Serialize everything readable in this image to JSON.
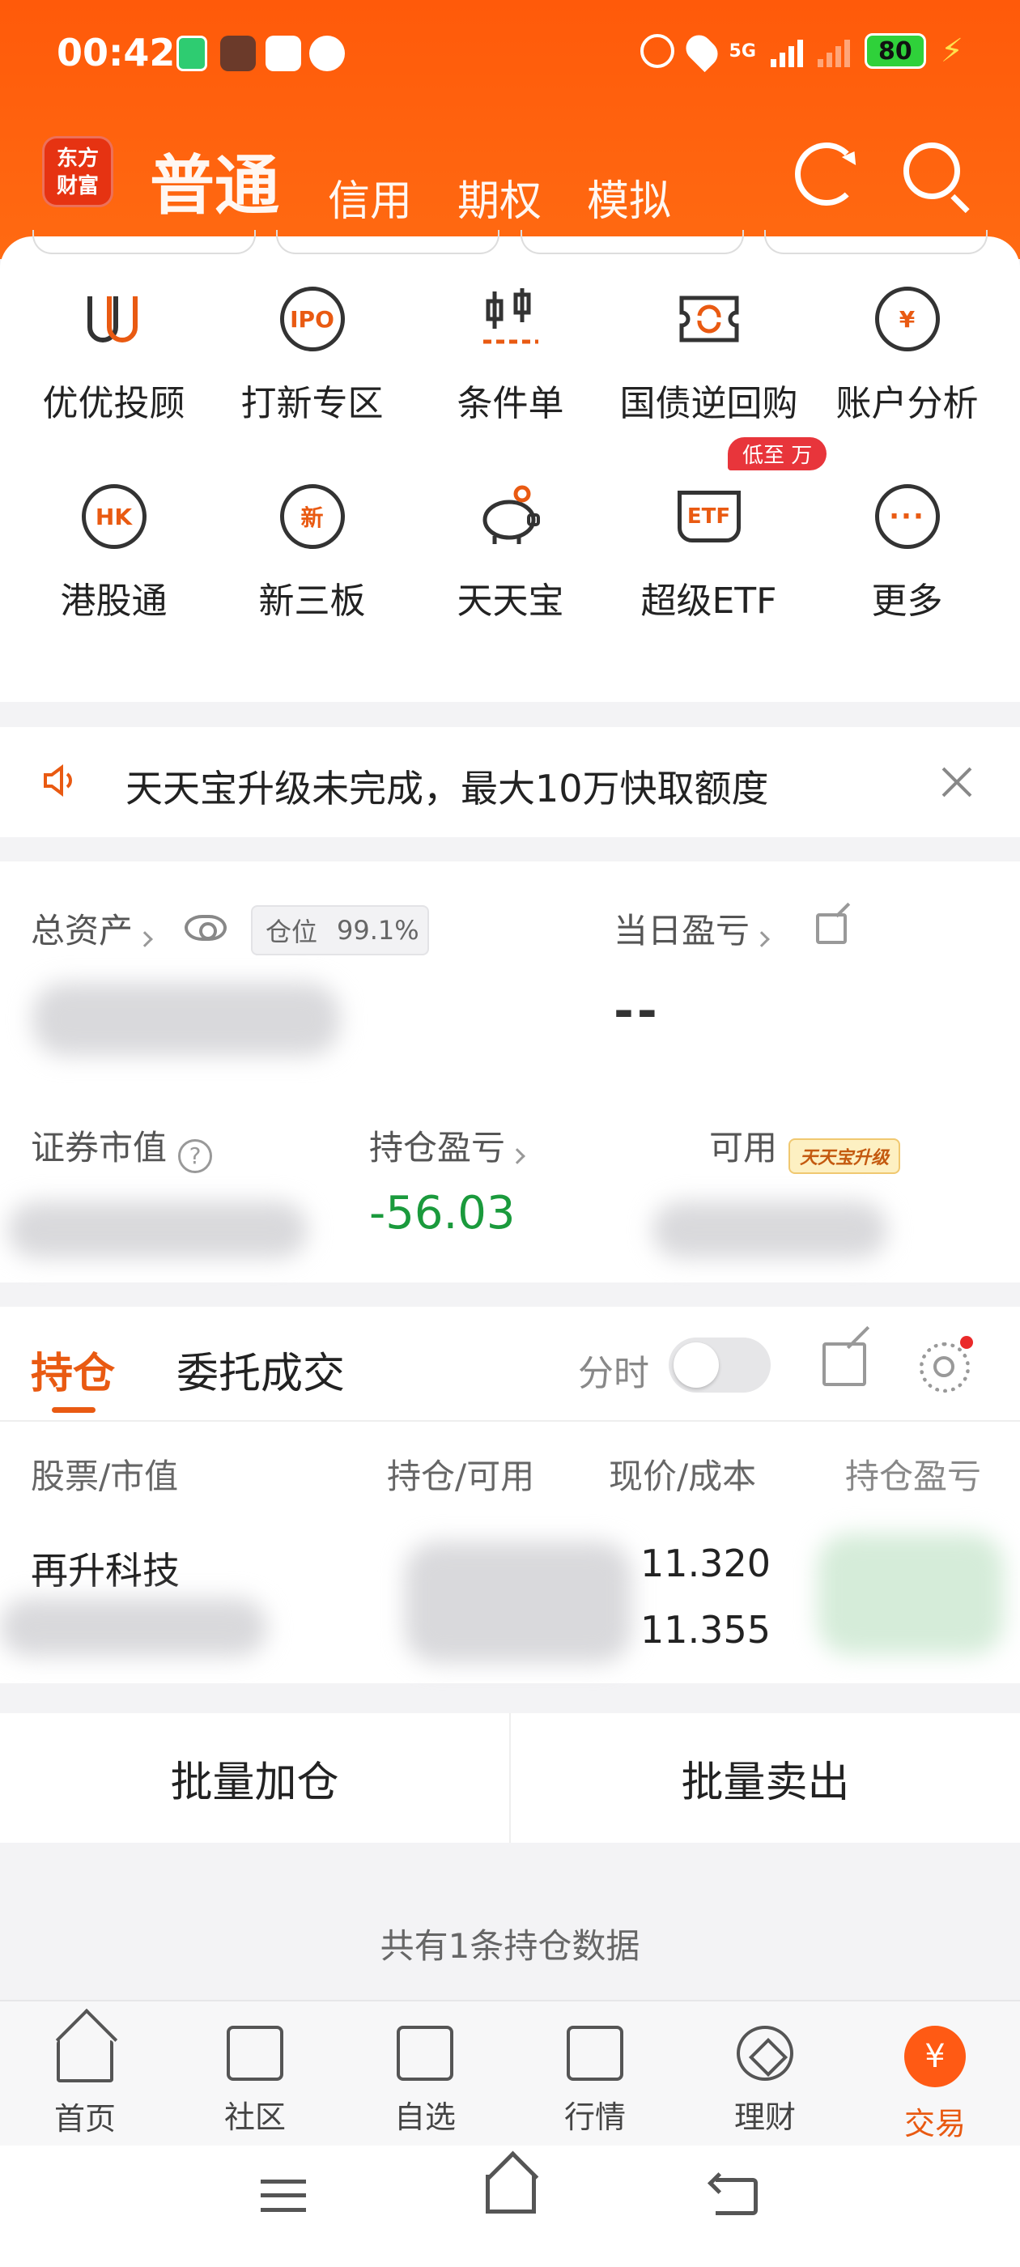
{
  "status_bar": {
    "time": "00:42",
    "network": "5G",
    "battery": "80"
  },
  "header": {
    "logo_text": "东方\n财富",
    "tabs": [
      {
        "label": "普通",
        "active": true
      },
      {
        "label": "信用",
        "active": false
      },
      {
        "label": "期权",
        "active": false
      },
      {
        "label": "模拟",
        "active": false
      }
    ]
  },
  "functions": [
    {
      "label": "优优投顾",
      "icon": "uu-advisor-icon"
    },
    {
      "label": "打新专区",
      "icon": "ipo-icon",
      "icon_text": "IPO"
    },
    {
      "label": "条件单",
      "icon": "condition-order-icon"
    },
    {
      "label": "国债逆回购",
      "icon": "reverse-repo-icon"
    },
    {
      "label": "账户分析",
      "icon": "account-analysis-icon",
      "icon_text": "¥"
    },
    {
      "label": "港股通",
      "icon": "hk-connect-icon",
      "icon_text": "HK"
    },
    {
      "label": "新三板",
      "icon": "neeq-icon",
      "icon_text": "新"
    },
    {
      "label": "天天宝",
      "icon": "piggy-bank-icon"
    },
    {
      "label": "超级ETF",
      "icon": "etf-icon",
      "icon_text": "ETF",
      "badge": "低至 万"
    },
    {
      "label": "更多",
      "icon": "more-icon",
      "icon_text": "···"
    }
  ],
  "notice": {
    "text": "天天宝升级未完成，最大10万快取额度"
  },
  "assets": {
    "total_label": "总资产",
    "position_label": "仓位",
    "position_value": "99.1%",
    "daily_pnl_label": "当日盈亏",
    "daily_pnl_value": "--",
    "market_value_label": "证券市值",
    "holding_pnl_label": "持仓盈亏",
    "holding_pnl_value": "-56.03",
    "available_label": "可用",
    "upgrade_tag": "天天宝升级"
  },
  "holdings": {
    "tab_active": "持仓",
    "tab_other": "委托成交",
    "split_label": "分时",
    "columns": [
      "股票/市值",
      "持仓/可用",
      "现价/成本",
      "持仓盈亏"
    ],
    "rows": [
      {
        "name": "再升科技",
        "price": "11.320",
        "cost": "11.355"
      }
    ]
  },
  "batch": {
    "add": "批量加仓",
    "sell": "批量卖出"
  },
  "holding_count_text": "共有1条持仓数据",
  "bottom_nav": [
    {
      "label": "首页",
      "icon": "home-icon"
    },
    {
      "label": "社区",
      "icon": "community-icon"
    },
    {
      "label": "自选",
      "icon": "watchlist-icon"
    },
    {
      "label": "行情",
      "icon": "market-icon"
    },
    {
      "label": "理财",
      "icon": "wealth-icon"
    },
    {
      "label": "交易",
      "icon": "trade-icon",
      "active": true
    }
  ],
  "colors": {
    "brand": "#ff5a0a",
    "accent": "#e95a12",
    "gain_green": "#1a9a3c",
    "badge_red": "#e8353b"
  }
}
